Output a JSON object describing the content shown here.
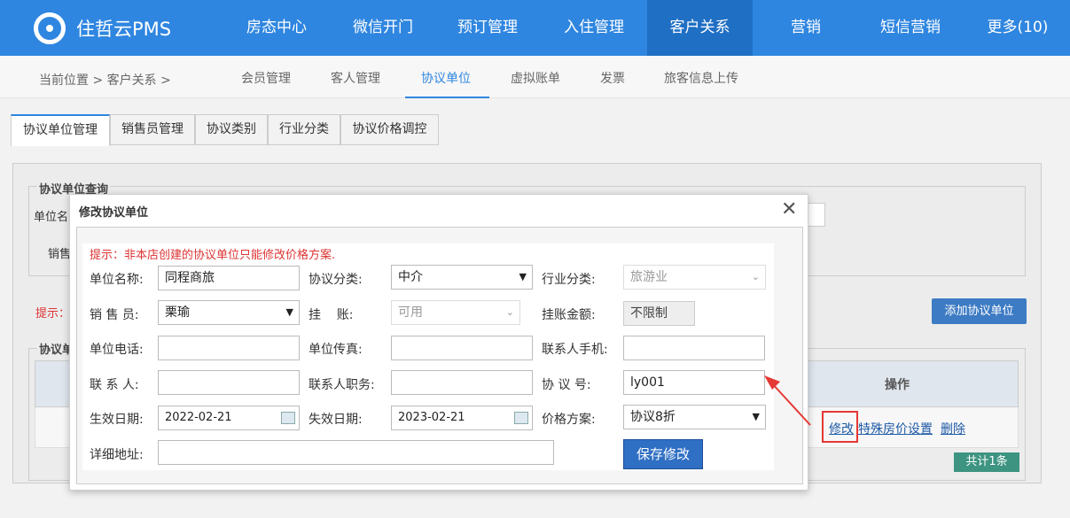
{
  "brand": "住哲云PMS",
  "nav": [
    "房态中心",
    "微信开门",
    "预订管理",
    "入住管理",
    "客户关系",
    "营销",
    "短信营销",
    "更多(10)"
  ],
  "breadcrumb": "当前位置 > 客户关系 >",
  "subtabs": [
    "会员管理",
    "客人管理",
    "协议单位",
    "虚拟账单",
    "发票",
    "旅客信息上传"
  ],
  "tabs": [
    "协议单位管理",
    "销售员管理",
    "协议类别",
    "行业分类",
    "协议价格调控"
  ],
  "query": {
    "title": "协议单位查询",
    "label1": "单位名",
    "label2": "销售"
  },
  "hint": "提示：",
  "add_button": "添加协议单位",
  "list": {
    "title": "协议单",
    "op_col": "操作",
    "links": [
      "修改",
      "特殊房价设置",
      "删除"
    ],
    "total": "共计1条"
  },
  "modal": {
    "title": "修改协议单位",
    "warning": "提示：非本店创建的协议单位只能修改价格方案.",
    "labels": {
      "unit_name": "单位名称:",
      "category": "协议分类:",
      "industry": "行业分类:",
      "sales": "销 售 员:",
      "credit": "挂    账:",
      "credit_amount": "挂账金额:",
      "phone": "单位电话:",
      "fax": "单位传真:",
      "contact_mobile": "联系人手机:",
      "contact": "联 系 人:",
      "contact_title": "联系人职务:",
      "agreement_no": "协 议 号:",
      "start_date": "生效日期:",
      "end_date": "失效日期:",
      "price_plan": "价格方案:",
      "address": "详细地址:"
    },
    "values": {
      "unit_name": "同程商旅",
      "category": "中介",
      "industry": "旅游业",
      "sales": "栗瑜",
      "credit": "可用",
      "credit_amount": "不限制",
      "phone": "",
      "fax": "",
      "contact_mobile": "",
      "contact": "",
      "contact_title": "",
      "agreement_no": "ly001",
      "start_date": "2022-02-21",
      "end_date": "2023-02-21",
      "price_plan": "协议8折",
      "address": ""
    },
    "save_button": "保存修改"
  }
}
